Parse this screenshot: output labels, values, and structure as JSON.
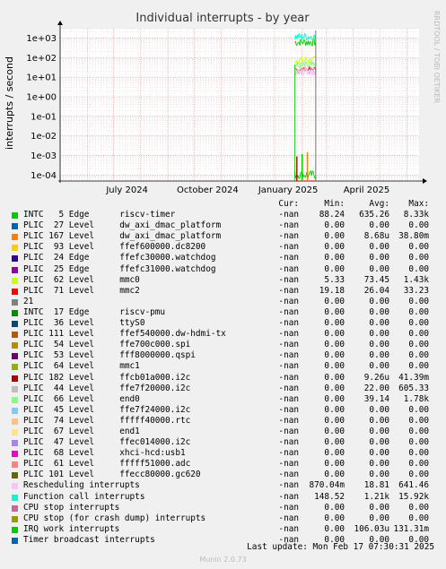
{
  "chart_data": {
    "type": "line",
    "title": "Individual interrupts - by year",
    "ylabel": "interrupts / second",
    "yscale": "log",
    "ylim": [
      5e-05,
      3000
    ],
    "y_ticks": [
      "1e+03",
      "1e+02",
      "1e+01",
      "1e+00",
      "1e-01",
      "1e-02",
      "1e-03",
      "1e-04"
    ],
    "x_ticks": [
      "July 2024",
      "October 2024",
      "January 2025",
      "April 2025"
    ],
    "x_range": [
      "2024-05-01",
      "2025-06-15"
    ],
    "data_start": "2025-01-24",
    "data_end": "2025-02-17",
    "grid": true,
    "side_text": "RRDTOOL / TOBI OETIKER",
    "columns": [
      "Cur:",
      "Min:",
      "Avg:",
      "Max:"
    ],
    "series": [
      {
        "name": "INTC   5 Edge      riscv-timer",
        "color": "#00cc00",
        "cur": "-nan",
        "min": "88.24",
        "avg": "635.26",
        "max": "8.33k"
      },
      {
        "name": "PLIC  27 Level     dw_axi_dmac_platform",
        "color": "#0066b3",
        "cur": "-nan",
        "min": "0.00",
        "avg": "0.00",
        "max": "0.00"
      },
      {
        "name": "PLIC 167 Level     dw_axi_dmac_platform",
        "color": "#ff8000",
        "cur": "-nan",
        "min": "0.00",
        "avg": "8.68u",
        "max": "38.80m"
      },
      {
        "name": "PLIC  93 Level     ffef600000.dc8200",
        "color": "#ffcc00",
        "cur": "-nan",
        "min": "0.00",
        "avg": "0.00",
        "max": "0.00"
      },
      {
        "name": "PLIC  24 Edge      ffefc30000.watchdog",
        "color": "#330099",
        "cur": "-nan",
        "min": "0.00",
        "avg": "0.00",
        "max": "0.00"
      },
      {
        "name": "PLIC  25 Edge      ffefc31000.watchdog",
        "color": "#990099",
        "cur": "-nan",
        "min": "0.00",
        "avg": "0.00",
        "max": "0.00"
      },
      {
        "name": "PLIC  62 Level     mmc0",
        "color": "#ccff00",
        "cur": "-nan",
        "min": "5.33",
        "avg": "73.45",
        "max": "1.43k"
      },
      {
        "name": "PLIC  71 Level     mmc2",
        "color": "#ff0000",
        "cur": "-nan",
        "min": "19.18",
        "avg": "26.04",
        "max": "33.23"
      },
      {
        "name": "21",
        "color": "#808080",
        "cur": "-nan",
        "min": "0.00",
        "avg": "0.00",
        "max": "0.00"
      },
      {
        "name": "INTC  17 Edge      riscv-pmu",
        "color": "#008f00",
        "cur": "-nan",
        "min": "0.00",
        "avg": "0.00",
        "max": "0.00"
      },
      {
        "name": "PLIC  36 Level     ttyS0",
        "color": "#00487d",
        "cur": "-nan",
        "min": "0.00",
        "avg": "0.00",
        "max": "0.00"
      },
      {
        "name": "PLIC 111 Level     ffef540000.dw-hdmi-tx",
        "color": "#b35a00",
        "cur": "-nan",
        "min": "0.00",
        "avg": "0.00",
        "max": "0.00"
      },
      {
        "name": "PLIC  54 Level     ffe700c000.spi",
        "color": "#b38f00",
        "cur": "-nan",
        "min": "0.00",
        "avg": "0.00",
        "max": "0.00"
      },
      {
        "name": "PLIC  53 Level     fff8000000.qspi",
        "color": "#6b006b",
        "cur": "-nan",
        "min": "0.00",
        "avg": "0.00",
        "max": "0.00"
      },
      {
        "name": "PLIC  64 Level     mmc1",
        "color": "#8fb300",
        "cur": "-nan",
        "min": "0.00",
        "avg": "0.00",
        "max": "0.00"
      },
      {
        "name": "PLIC 182 Level     ffcb01a000.i2c",
        "color": "#b30000",
        "cur": "-nan",
        "min": "0.00",
        "avg": "9.26u",
        "max": "41.39m"
      },
      {
        "name": "PLIC  44 Level     ffe7f20000.i2c",
        "color": "#bebebe",
        "cur": "-nan",
        "min": "0.00",
        "avg": "22.00",
        "max": "605.33"
      },
      {
        "name": "PLIC  66 Level     end0",
        "color": "#80ff80",
        "cur": "-nan",
        "min": "0.00",
        "avg": "39.14",
        "max": "1.78k"
      },
      {
        "name": "PLIC  45 Level     ffe7f24000.i2c",
        "color": "#80c9ff",
        "cur": "-nan",
        "min": "0.00",
        "avg": "0.00",
        "max": "0.00"
      },
      {
        "name": "PLIC  74 Level     fffff40000.rtc",
        "color": "#ffc080",
        "cur": "-nan",
        "min": "0.00",
        "avg": "0.00",
        "max": "0.00"
      },
      {
        "name": "PLIC  67 Level     end1",
        "color": "#ffe680",
        "cur": "-nan",
        "min": "0.00",
        "avg": "0.00",
        "max": "0.00"
      },
      {
        "name": "PLIC  47 Level     ffec014000.i2c",
        "color": "#aa80ff",
        "cur": "-nan",
        "min": "0.00",
        "avg": "0.00",
        "max": "0.00"
      },
      {
        "name": "PLIC  68 Level     xhci-hcd:usb1",
        "color": "#ee00cc",
        "cur": "-nan",
        "min": "0.00",
        "avg": "0.00",
        "max": "0.00"
      },
      {
        "name": "PLIC  61 Level     fffff51000.adc",
        "color": "#ff8080",
        "cur": "-nan",
        "min": "0.00",
        "avg": "0.00",
        "max": "0.00"
      },
      {
        "name": "PLIC 101 Level     ffecc80000.gc620",
        "color": "#666600",
        "cur": "-nan",
        "min": "0.00",
        "avg": "0.00",
        "max": "0.00"
      },
      {
        "name": "Rescheduling interrupts",
        "color": "#ffbfff",
        "cur": "-nan",
        "min": "870.04m",
        "avg": "18.81",
        "max": "641.46"
      },
      {
        "name": "Function call interrupts",
        "color": "#00ffcc",
        "cur": "-nan",
        "min": "148.52",
        "avg": "1.21k",
        "max": "15.92k"
      },
      {
        "name": "CPU stop interrupts",
        "color": "#cc6699",
        "cur": "-nan",
        "min": "0.00",
        "avg": "0.00",
        "max": "0.00"
      },
      {
        "name": "CPU stop (for crash dump) interrupts",
        "color": "#999900",
        "cur": "-nan",
        "min": "0.00",
        "avg": "0.00",
        "max": "0.00"
      },
      {
        "name": "IRQ work interrupts",
        "color": "#00cc00",
        "cur": "-nan",
        "min": "0.00",
        "avg": "106.03u",
        "max": "131.31m"
      },
      {
        "name": "Timer broadcast interrupts",
        "color": "#0066b3",
        "cur": "-nan",
        "min": "0.00",
        "avg": "0.00",
        "max": "0.00"
      }
    ],
    "last_update": "Last update: Mon Feb 17 07:30:31 2025",
    "footer": "Munin 2.0.73"
  }
}
